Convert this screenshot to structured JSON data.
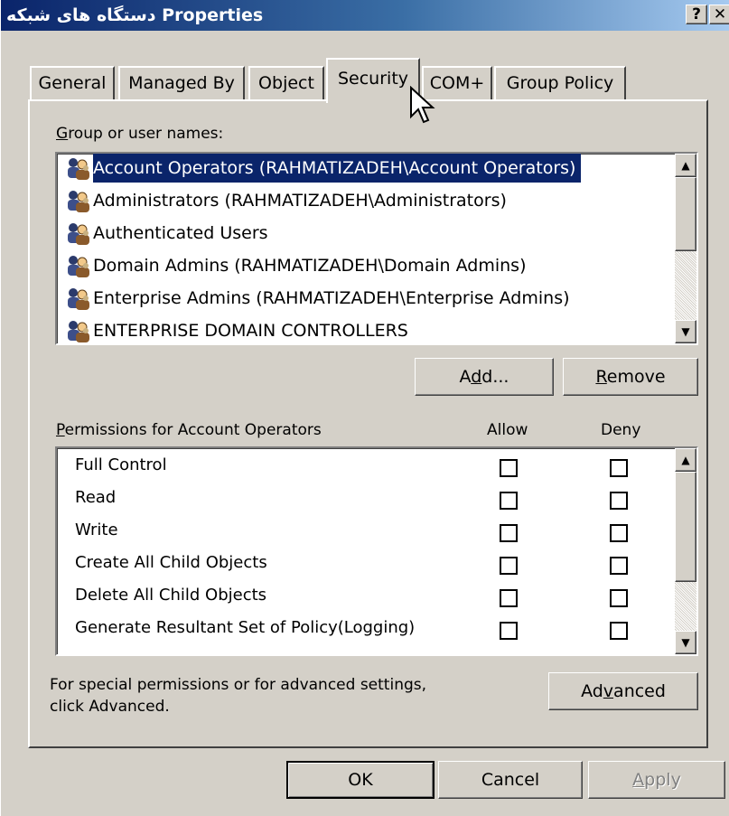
{
  "window": {
    "title": "دستگاه های شبکه Properties",
    "help_button": "?",
    "close_button": "✕"
  },
  "tabs": [
    {
      "label": "General"
    },
    {
      "label": "Managed By"
    },
    {
      "label": "Object"
    },
    {
      "label": "Security"
    },
    {
      "label": "COM+"
    },
    {
      "label": "Group Policy"
    }
  ],
  "selected_tab": "Security",
  "security": {
    "group_label_prefix": "G",
    "group_label_rest": "roup or user names:",
    "groups": [
      {
        "name": "Account Operators (RAHMATIZADEH\\Account Operators)"
      },
      {
        "name": "Administrators (RAHMATIZADEH\\Administrators)"
      },
      {
        "name": "Authenticated Users"
      },
      {
        "name": "Domain Admins (RAHMATIZADEH\\Domain Admins)"
      },
      {
        "name": "Enterprise Admins (RAHMATIZADEH\\Enterprise Admins)"
      },
      {
        "name": "ENTERPRISE DOMAIN CONTROLLERS"
      }
    ],
    "selected_group_index": 0,
    "add_button": {
      "before": "A",
      "mnemonic": "d",
      "after": "d..."
    },
    "remove_button": {
      "before": "",
      "mnemonic": "R",
      "after": "emove"
    },
    "permissions_label": {
      "before": "",
      "mnemonic": "P",
      "after": "ermissions for Account Operators"
    },
    "allow_header": "Allow",
    "deny_header": "Deny",
    "permissions": [
      {
        "name": "Full Control",
        "allow": false,
        "deny": false
      },
      {
        "name": "Read",
        "allow": false,
        "deny": false
      },
      {
        "name": "Write",
        "allow": false,
        "deny": false
      },
      {
        "name": "Create All Child Objects",
        "allow": false,
        "deny": false
      },
      {
        "name": "Delete All Child Objects",
        "allow": false,
        "deny": false
      },
      {
        "name": "Generate Resultant Set of Policy(Logging)",
        "allow": false,
        "deny": false
      }
    ],
    "advanced_note_line1": "For special permissions or for advanced settings,",
    "advanced_note_line2": "click Advanced.",
    "advanced_button": {
      "before": "Ad",
      "mnemonic": "v",
      "after": "anced"
    }
  },
  "buttons": {
    "ok": "OK",
    "cancel": "Cancel",
    "apply": {
      "before": "",
      "mnemonic": "A",
      "after": "pply"
    }
  },
  "colors": {
    "selection": "#0a246a",
    "face": "#d4d0c8"
  }
}
